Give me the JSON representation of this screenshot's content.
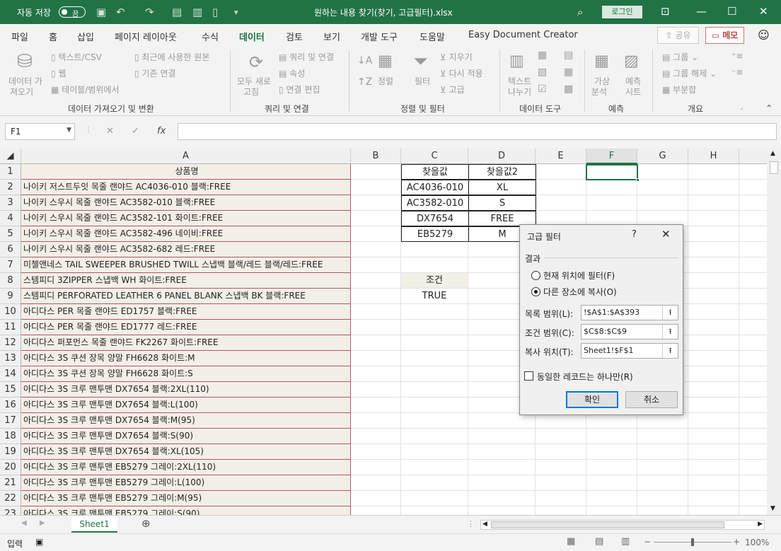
{
  "titlebar": {
    "autosave_label": "자동 저장",
    "autosave_state": "끔",
    "file_title": "원하는 내용 찾기(찾기, 고급필터).xlsx",
    "login_label": "로그인"
  },
  "tabs": [
    "파일",
    "홈",
    "삽입",
    "페이지 레이아웃",
    "수식",
    "데이터",
    "검토",
    "보기",
    "개발 도구",
    "도움말",
    "Easy Document Creator"
  ],
  "active_tab": "데이터",
  "share_label": "공유",
  "memo_label": "메모",
  "ribbon": {
    "get_data": [
      "데이터 가",
      "져오기"
    ],
    "text_csv": "텍스트/CSV",
    "web": "웹",
    "table_range": "테이블/범위에서",
    "recent_sources": "최근에 사용한 원본",
    "existing_conn": "기존 연결",
    "refresh_all": [
      "모두 새로",
      "고침"
    ],
    "queries_conn": "쿼리 및 연결",
    "properties": "속성",
    "edit_links": "연결 편집",
    "sort": "정렬",
    "filter": "필터",
    "clear": "지우기",
    "reapply": "다시 적용",
    "advanced": "고급",
    "text_to_cols": [
      "텍스트",
      "나누기"
    ],
    "whatif": [
      "가상",
      "분석"
    ],
    "forecast": [
      "예측",
      "시트"
    ],
    "group": "그룹",
    "ungroup": "그룹 해제",
    "subtotal": "부분합",
    "groups": [
      "데이터 가져오기 및 변환",
      "쿼리 및 연결",
      "정렬 및 필터",
      "데이터 도구",
      "예측",
      "개요"
    ]
  },
  "namebox": "F1",
  "formula": "",
  "columns": [
    "A",
    "B",
    "C",
    "D",
    "E",
    "F",
    "G",
    "H"
  ],
  "selected_column": "F",
  "rows": [
    "상품명",
    "나이키 저스트두잇 목줄 랜야드 AC4036-010 블랙:FREE",
    "나이키 스우시 목줄 랜야드 AC3582-010 블랙:FREE",
    "나이키 스우시 목줄 랜야드 AC3582-101 화이트:FREE",
    "나이키 스우시 목줄 랜야드 AC3582-496 네이비:FREE",
    "나이키 스우시 목줄 랜야드 AC3582-682 레드:FREE",
    "미첼앤네스 TAIL SWEEPER BRUSHED TWILL 스냅백 블랙/레드 블랙/레드:FREE",
    "스템피디 3ZIPPER 스냅백 WH 화이트:FREE",
    "스템피디 PERFORATED LEATHER 6 PANEL BLANK 스냅백 BK 블랙:FREE",
    "아디다스 PER 목줄 랜야드 ED1757 블랙:FREE",
    "아디다스 PER 목줄 랜야드 ED1777 레드:FREE",
    "아디다스 퍼포먼스 목줄 랜야드 FK2267 화이트:FREE",
    "아디다스 3S 쿠션 장목 양말 FH6628 화이트:M",
    "아디다스 3S 쿠션 장목 양말 FH6628 화이트:S",
    "아디다스 3S 크루 맨투맨 DX7654 블랙:2XL(110)",
    "아디다스 3S 크루 맨투맨 DX7654 블랙:L(100)",
    "아디다스 3S 크루 맨투맨 DX7654 블랙:M(95)",
    "아디다스 3S 크루 맨투맨 DX7654 블랙:S(90)",
    "아디다스 3S 크루 맨투맨 DX7654 블랙:XL(105)",
    "아디다스 3S 크루 맨투맨 EB5279 그레이:2XL(110)",
    "아디다스 3S 크루 맨투맨 EB5279 그레이:L(100)",
    "아디다스 3S 크루 맨투맨 EB5279 그레이:M(95)",
    "아디다스 3S 크루 맨투맨 EB5279 그레이:S(90)"
  ],
  "criteria": {
    "h1": "찾을값",
    "h2": "찾을값2",
    "c": [
      "AC4036-010",
      "AC3582-010",
      "DX7654",
      "EB5279"
    ],
    "d": [
      "XL",
      "S",
      "FREE",
      "M"
    ],
    "cond_label": "조건",
    "cond_value": "TRUE"
  },
  "dialog": {
    "title": "고급 필터",
    "help": "?",
    "result_label": "결과",
    "opt1": "현재 위치에 필터(F)",
    "opt2": "다른 장소에 복사(O)",
    "list_range_label": "목록 범위(L):",
    "list_range": "!$A$1:$A$393",
    "criteria_range_label": "조건 범위(C):",
    "criteria_range": "$C$8:$C$9",
    "copy_to_label": "복사 위치(T):",
    "copy_to": "Sheet1!$F$1",
    "unique_label": "동일한 레코드는 하나만(R)",
    "ok": "확인",
    "cancel": "취소"
  },
  "sheet_tab": "Sheet1",
  "status": {
    "mode": "입력",
    "zoom": "100%"
  },
  "colors": {
    "brand": "#217346",
    "cell_fill": "#f2efe7",
    "border_accent": "#b0566a"
  }
}
